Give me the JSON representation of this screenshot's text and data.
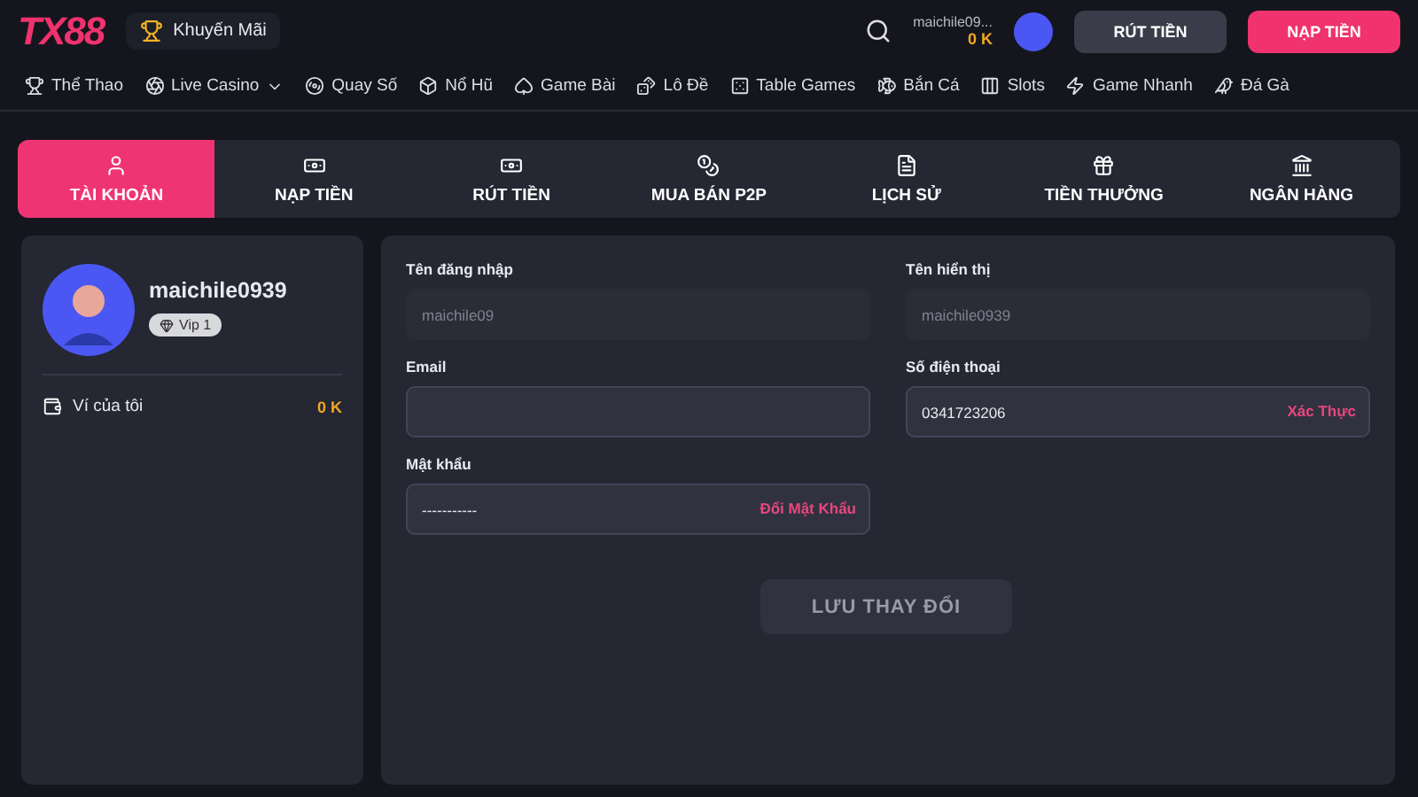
{
  "header": {
    "logo": "TX88",
    "promo": "Khuyến Mãi",
    "user": {
      "name": "maichile09...",
      "balance": "0 K"
    },
    "buttons": [
      {
        "label": "RÚT TIỀN",
        "kind": "secondary"
      },
      {
        "label": "NẠP TIỀN",
        "kind": "primary"
      }
    ]
  },
  "nav": [
    {
      "label": "Thể Thao",
      "dropdown": false
    },
    {
      "label": "Live Casino",
      "dropdown": true
    },
    {
      "label": "Quay Số",
      "dropdown": false
    },
    {
      "label": "Nổ Hũ",
      "dropdown": false
    },
    {
      "label": "Game Bài",
      "dropdown": false
    },
    {
      "label": "Lô Đề",
      "dropdown": false
    },
    {
      "label": "Table Games",
      "dropdown": false
    },
    {
      "label": "Bắn Cá",
      "dropdown": false
    },
    {
      "label": "Slots",
      "dropdown": false
    },
    {
      "label": "Game Nhanh",
      "dropdown": false
    },
    {
      "label": "Đá Gà",
      "dropdown": false
    }
  ],
  "tabs": [
    {
      "label": "TÀI KHOẢN",
      "selected": true
    },
    {
      "label": "NẠP TIỀN",
      "selected": false
    },
    {
      "label": "RÚT TIỀN",
      "selected": false
    },
    {
      "label": "MUA BÁN P2P",
      "selected": false
    },
    {
      "label": "LỊCH SỬ",
      "selected": false
    },
    {
      "label": "TIỀN THƯỞNG",
      "selected": false
    },
    {
      "label": "NGÂN HÀNG",
      "selected": false
    }
  ],
  "profile": {
    "username": "maichile0939",
    "vip": "Vip 1",
    "wallet_label": "Ví của tôi",
    "wallet_amount": "0 K"
  },
  "form": {
    "fields": [
      {
        "label": "Tên đăng nhập",
        "value": "maichile09",
        "disabled": true
      },
      {
        "label": "Tên hiển thị",
        "value": "maichile0939",
        "disabled": true
      },
      {
        "label": "Email",
        "disabled": false
      },
      {
        "label": "Số điện thoại",
        "value": "0341723206",
        "disabled": false,
        "action": "Xác Thực"
      },
      {
        "label": "Mật khẩu",
        "value": "-----------",
        "disabled": false,
        "action": "Đổi Mật Khẩu"
      }
    ],
    "save": {
      "label": "LƯU THAY ĐỔI",
      "disabled": true
    }
  }
}
